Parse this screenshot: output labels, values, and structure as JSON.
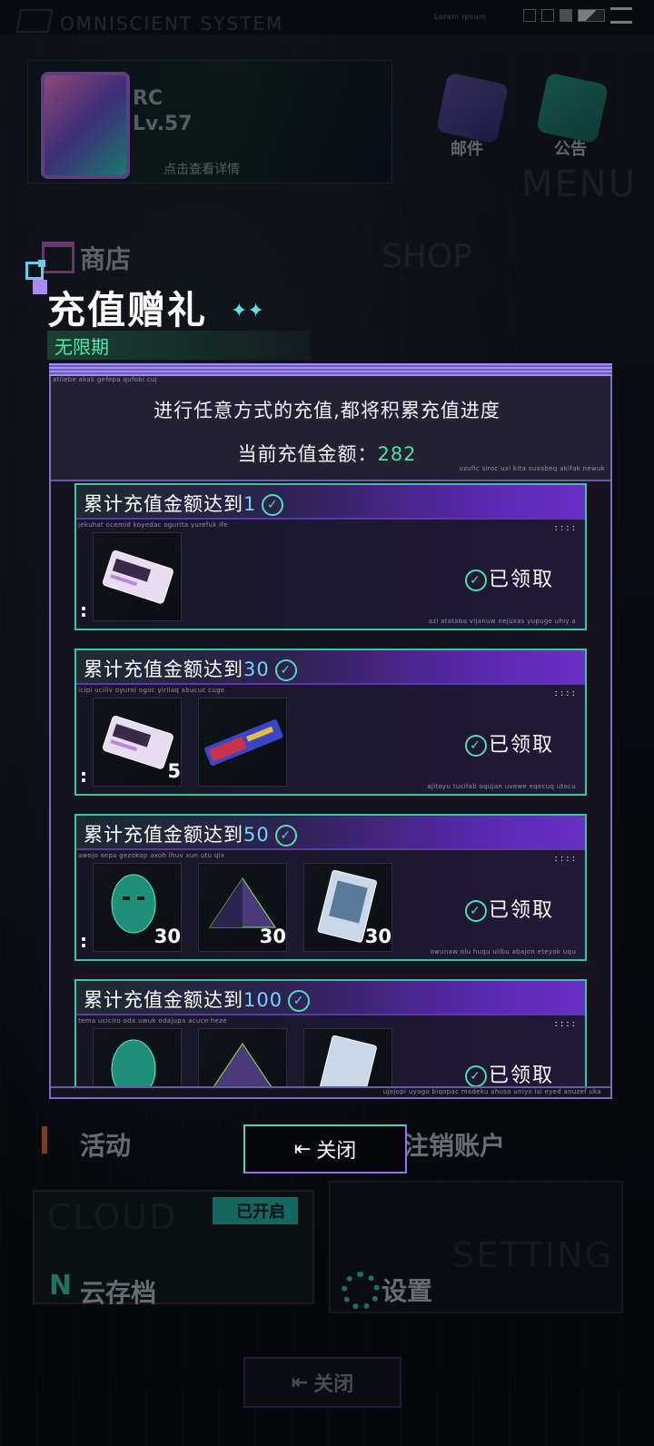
{
  "background": {
    "system_name": "OMNISCIENT SYSTEM",
    "top_tiny": "Lorem ipsum",
    "profile": {
      "name": "RC",
      "level": "Lv.57",
      "detail": "点击查看详情"
    },
    "mail_label": "邮件",
    "notice_label": "公告",
    "menu_word": "MENU",
    "shop_word": "SHOP",
    "shop_label": "商店",
    "activity_label": "活动",
    "account_label": "注销账户",
    "cloud_word": "CLOUD",
    "cloud_status": "已开启",
    "cloud_label": "云存档",
    "setting_word": "SETTING",
    "setting_label": "设置",
    "close_label": "关闭"
  },
  "modal": {
    "title": "充值赠礼",
    "sparkle": "✦✦",
    "subtitle": "无限期",
    "info_line1": "进行任意方式的充值,都将积累充值进度",
    "info_label": "当前充值金额：",
    "info_amount": "282",
    "noise_top": "atilebe akak gefepa qufobi cuj",
    "noise_info": "uzufic siroc uxi kita suxabeq akifak newuk",
    "noise_bottom": "ujejopi uyago biqopac madeku ahuso uniyo isi eyed anuzef uka",
    "close_label": "关闭",
    "cards": [
      {
        "title": "累计充值金额达到",
        "target": "1",
        "noise1": "jekuhat ocemid koyedac ogurita yurefuk ife",
        "noise2": "azi atataba vijanuw nejuxas yupuge uhiy a",
        "status": "已领取",
        "items": [
          {
            "icon": "ticket-icon",
            "qty": ""
          }
        ]
      },
      {
        "title": "累计充值金额达到",
        "target": "30",
        "noise1": "icipi uciliv oyurol ogoc yirilaq abucuc cuge",
        "noise2": "ajitoyu tucifab oqujan uvewe eqecuq utocu",
        "status": "已领取",
        "items": [
          {
            "icon": "ticket-icon",
            "qty": "5"
          },
          {
            "icon": "weapon-card-icon",
            "qty": ""
          }
        ]
      },
      {
        "title": "累计充值金额达到",
        "target": "50",
        "noise1": "awojo xepa gezokop axoh ihuv xun utu qix",
        "noise2": "owunaw olu huqu ulibu abajon eteyok uqu",
        "status": "已领取",
        "items": [
          {
            "icon": "mask-icon",
            "qty": "30"
          },
          {
            "icon": "pyramid-icon",
            "qty": "30"
          },
          {
            "icon": "chip-card-icon",
            "qty": "30"
          }
        ]
      },
      {
        "title": "累计充值金额达到",
        "target": "100",
        "noise1": "tema uciciro oda uwuk odajupa acuce heze",
        "noise2": "",
        "status": "已领取",
        "items": [
          {
            "icon": "mask-icon",
            "qty": ""
          },
          {
            "icon": "pyramid-icon",
            "qty": ""
          },
          {
            "icon": "chip-card-icon",
            "qty": ""
          }
        ]
      }
    ]
  },
  "colors": {
    "accent_green": "#4ee0b0",
    "accent_purple": "#6a30c8",
    "amount": "#4fe0a6",
    "target_blue": "#6fd6ff"
  }
}
